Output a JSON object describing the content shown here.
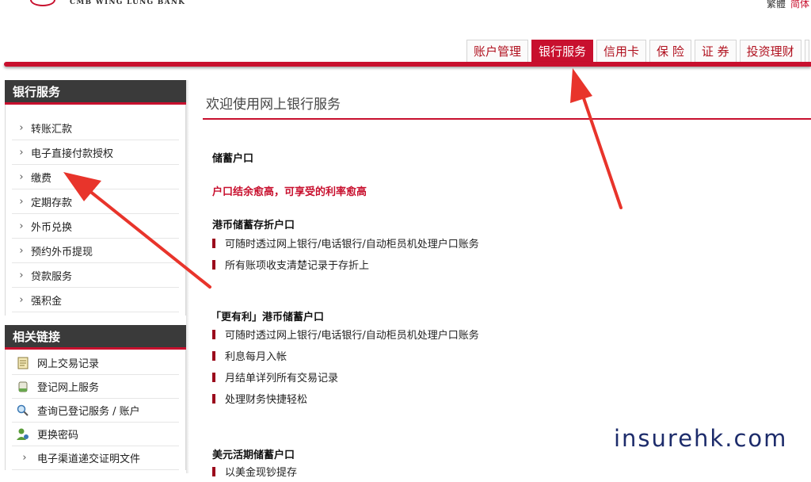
{
  "header": {
    "brand": "CMB WING LUNG BANK",
    "lang_trad": "繁體",
    "lang_simp": "简体"
  },
  "tabs": [
    {
      "label": "账户管理",
      "active": false
    },
    {
      "label": "银行服务",
      "active": true
    },
    {
      "label": "信用卡",
      "active": false
    },
    {
      "label": "保 险",
      "active": false
    },
    {
      "label": "证 券",
      "active": false
    },
    {
      "label": "投资理财",
      "active": false
    }
  ],
  "sidebar": {
    "title": "银行服务",
    "items": [
      "转账汇款",
      "电子直接付款授权",
      "缴费",
      "定期存款",
      "外币兑换",
      "预约外币提现",
      "贷款服务",
      "强积金"
    ],
    "links_title": "相关链接",
    "links": [
      {
        "label": "网上交易记录",
        "icon": "notepad-icon"
      },
      {
        "label": "登记网上服务",
        "icon": "scroll-icon"
      },
      {
        "label": "查询已登记服务 / 账户",
        "icon": "magnifier-icon"
      },
      {
        "label": "更换密码",
        "icon": "user-key-icon"
      },
      {
        "label": "电子渠道递交证明文件",
        "icon": "chevron-right-icon"
      }
    ]
  },
  "main": {
    "title": "欢迎使用网上银行服务",
    "s1_heading": "储蓄户口",
    "s1_promo": "户口结余愈高，可享受的利率愈高",
    "s2_heading": "港币储蓄存折户口",
    "s2_bullets": [
      "可随时透过网上银行/电话银行/自动柜员机处理户口账务",
      "所有账项收支清楚记录于存折上"
    ],
    "s3_heading": "「更有利」港币储蓄户口",
    "s3_bullets": [
      "可随时透过网上银行/电话银行/自动柜员机处理户口账务",
      "利息每月入帐",
      "月结单详列所有交易记录",
      "处理财务快捷轻松"
    ],
    "s4_heading": "美元活期储蓄户口",
    "s4_bullets": [
      "以美金现钞提存"
    ]
  },
  "watermark": "insurehk.com",
  "colors": {
    "accent": "#c8102e",
    "dark_header": "#3a3a3a",
    "arrow": "#e8342b"
  }
}
